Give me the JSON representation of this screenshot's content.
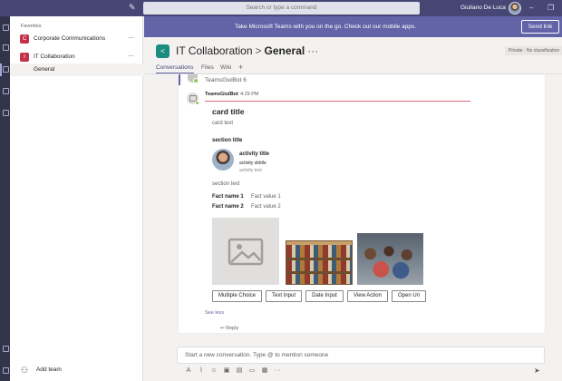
{
  "titlebar": {
    "search_placeholder": "Search or type a command",
    "user_name": "Giuliano De Luca"
  },
  "sidebar": {
    "favorites_label": "Favorites",
    "teams": [
      {
        "initial": "C",
        "name": "Corporate Communications",
        "color": "#c4314b"
      },
      {
        "initial": "I",
        "name": "IT Collaboration",
        "color": "#c4314b"
      }
    ],
    "channels": [
      {
        "name": "General"
      }
    ],
    "add_team_label": "Add team"
  },
  "banner": {
    "text": "Take Microsoft Teams with you on the go. Check out our mobile apps.",
    "button_label": "Send link"
  },
  "channel_header": {
    "team": "IT Collaboration",
    "separator": ">",
    "channel": "General",
    "more": "···",
    "privacy": "Private · No classification",
    "tabs": [
      "Conversations",
      "Files",
      "Wiki"
    ],
    "add_tab": "+"
  },
  "thread": {
    "previous_sender": "TeamsGiulBot 6",
    "message": {
      "sender": "TeamsGiulBot",
      "time": "4:29 PM"
    },
    "card": {
      "title": "card title",
      "text": "card text",
      "section_title": "section title",
      "activity_title": "activity title",
      "activity_subtitle": "activity sbtitle",
      "activity_text": "activity text",
      "section_text": "section text",
      "facts": [
        {
          "name": "Fact name 1",
          "value": "Fact value 1"
        },
        {
          "name": "Fact name 2",
          "value": "Fact value 2"
        }
      ],
      "actions": [
        "Multiple Choice",
        "Text Input",
        "Date Input",
        "View Action",
        "Open Uri"
      ]
    },
    "see_less": "See less",
    "reply": "Reply"
  },
  "compose": {
    "placeholder": "Start a new conversation. Type @ to mention someone"
  },
  "colors": {
    "titlebar": "#464775",
    "banner": "#6264a7",
    "team_tile": "#c4314b",
    "channel_tile": "#1b8d7f"
  }
}
